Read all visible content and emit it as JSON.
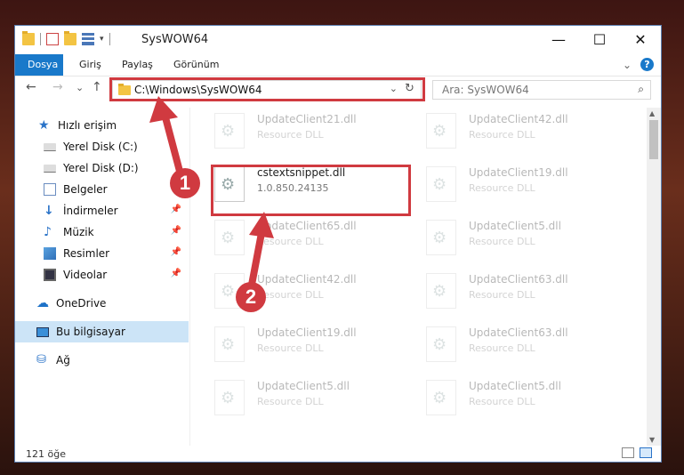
{
  "window": {
    "title": "SysWOW64",
    "buttons": {
      "minimize": "—",
      "maximize": "☐",
      "close": "✕"
    }
  },
  "ribbon": {
    "tabs": [
      "Dosya",
      "Giriş",
      "Paylaş",
      "Görünüm"
    ],
    "active_tab": "Dosya",
    "accent": "#1979ca",
    "expand": "⌄",
    "help": "?"
  },
  "nav": {
    "back": "←",
    "forward": "→",
    "recent": "⌄",
    "up": "↑",
    "address": "C:\\Windows\\SysWOW64",
    "address_dropdown": "⌄",
    "refresh": "↻",
    "search_placeholder": "Ara: SysWOW64",
    "search_icon": "⌕"
  },
  "sidebar": {
    "items": [
      {
        "label": "Hızlı erişim",
        "icon": "star-icon"
      },
      {
        "label": "Yerel Disk (C:)",
        "icon": "disk-icon"
      },
      {
        "label": "Yerel Disk (D:)",
        "icon": "disk-icon"
      },
      {
        "label": "Belgeler",
        "icon": "documents-icon"
      },
      {
        "label": "İndirmeler",
        "icon": "downloads-icon",
        "pinned": true
      },
      {
        "label": "Müzik",
        "icon": "music-icon",
        "pinned": true
      },
      {
        "label": "Resimler",
        "icon": "pictures-icon",
        "pinned": true
      },
      {
        "label": "Videolar",
        "icon": "videos-icon",
        "pinned": true
      },
      {
        "label": "OneDrive",
        "icon": "cloud-icon"
      },
      {
        "label": "Bu bilgisayar",
        "icon": "computer-icon",
        "selected": true
      },
      {
        "label": "Ağ",
        "icon": "network-icon"
      }
    ],
    "pin_glyph": "📌"
  },
  "files": {
    "left": [
      {
        "name": "UpdateClient21.dll",
        "type": "Resource DLL"
      },
      {
        "name": "cstextsnippet.dll",
        "type": "1.0.850.24135",
        "highlighted": true
      },
      {
        "name": "UpdateClient65.dll",
        "type": "Resource DLL"
      },
      {
        "name": "UpdateClient42.dll",
        "type": "Resource DLL"
      },
      {
        "name": "UpdateClient19.dll",
        "type": "Resource DLL"
      },
      {
        "name": "UpdateClient5.dll",
        "type": "Resource DLL"
      }
    ],
    "right": [
      {
        "name": "UpdateClient42.dll",
        "type": "Resource DLL"
      },
      {
        "name": "UpdateClient19.dll",
        "type": "Resource DLL"
      },
      {
        "name": "UpdateClient5.dll",
        "type": "Resource DLL"
      },
      {
        "name": "UpdateClient63.dll",
        "type": "Resource DLL"
      },
      {
        "name": "UpdateClient63.dll",
        "type": "Resource DLL"
      },
      {
        "name": "UpdateClient5.dll",
        "type": "Resource DLL"
      }
    ]
  },
  "status": {
    "count": "121 öğe"
  },
  "annotations": {
    "step1": "1",
    "step2": "2",
    "color": "#d03a40"
  }
}
